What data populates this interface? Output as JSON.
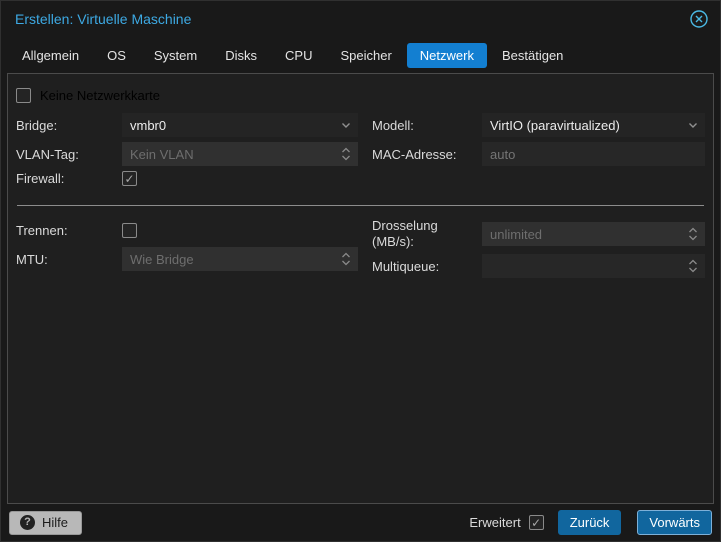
{
  "window": {
    "title": "Erstellen: Virtuelle Maschine"
  },
  "tabs": [
    {
      "label": "Allgemein",
      "active": false
    },
    {
      "label": "OS",
      "active": false
    },
    {
      "label": "System",
      "active": false
    },
    {
      "label": "Disks",
      "active": false
    },
    {
      "label": "CPU",
      "active": false
    },
    {
      "label": "Speicher",
      "active": false
    },
    {
      "label": "Netzwerk",
      "active": true
    },
    {
      "label": "Bestätigen",
      "active": false
    }
  ],
  "form": {
    "no_nic": {
      "label": "Keine Netzwerkkarte",
      "checked": false
    },
    "bridge": {
      "label": "Bridge:",
      "value": "vmbr0"
    },
    "vlan": {
      "label": "VLAN-Tag:",
      "placeholder": "Kein VLAN",
      "disabled": true
    },
    "firewall": {
      "label": "Firewall:",
      "checked": true
    },
    "model": {
      "label": "Modell:",
      "value": "VirtIO (paravirtualized)"
    },
    "mac": {
      "label": "MAC-Adresse:",
      "placeholder": "auto"
    },
    "disconnect": {
      "label": "Trennen:",
      "checked": false
    },
    "mtu": {
      "label": "MTU:",
      "placeholder": "Wie Bridge",
      "disabled": true
    },
    "rate": {
      "label": "Drosselung (MB/s):",
      "placeholder": "unlimited",
      "disabled": true
    },
    "multiqueue": {
      "label": "Multiqueue:",
      "placeholder": ""
    }
  },
  "footer": {
    "help_label": "Hilfe",
    "advanced": {
      "label": "Erweitert",
      "checked": true
    },
    "back_label": "Zurück",
    "next_label": "Vorwärts"
  },
  "colors": {
    "accent_tab_blue": "#137fd1",
    "button_blue": "#11669e",
    "title_blue": "#3da9e3",
    "next_button_border": "#7db0d8",
    "panel_background": "#1f1f1f",
    "field_background": "#272727",
    "disabled_field_background": "#303030"
  }
}
